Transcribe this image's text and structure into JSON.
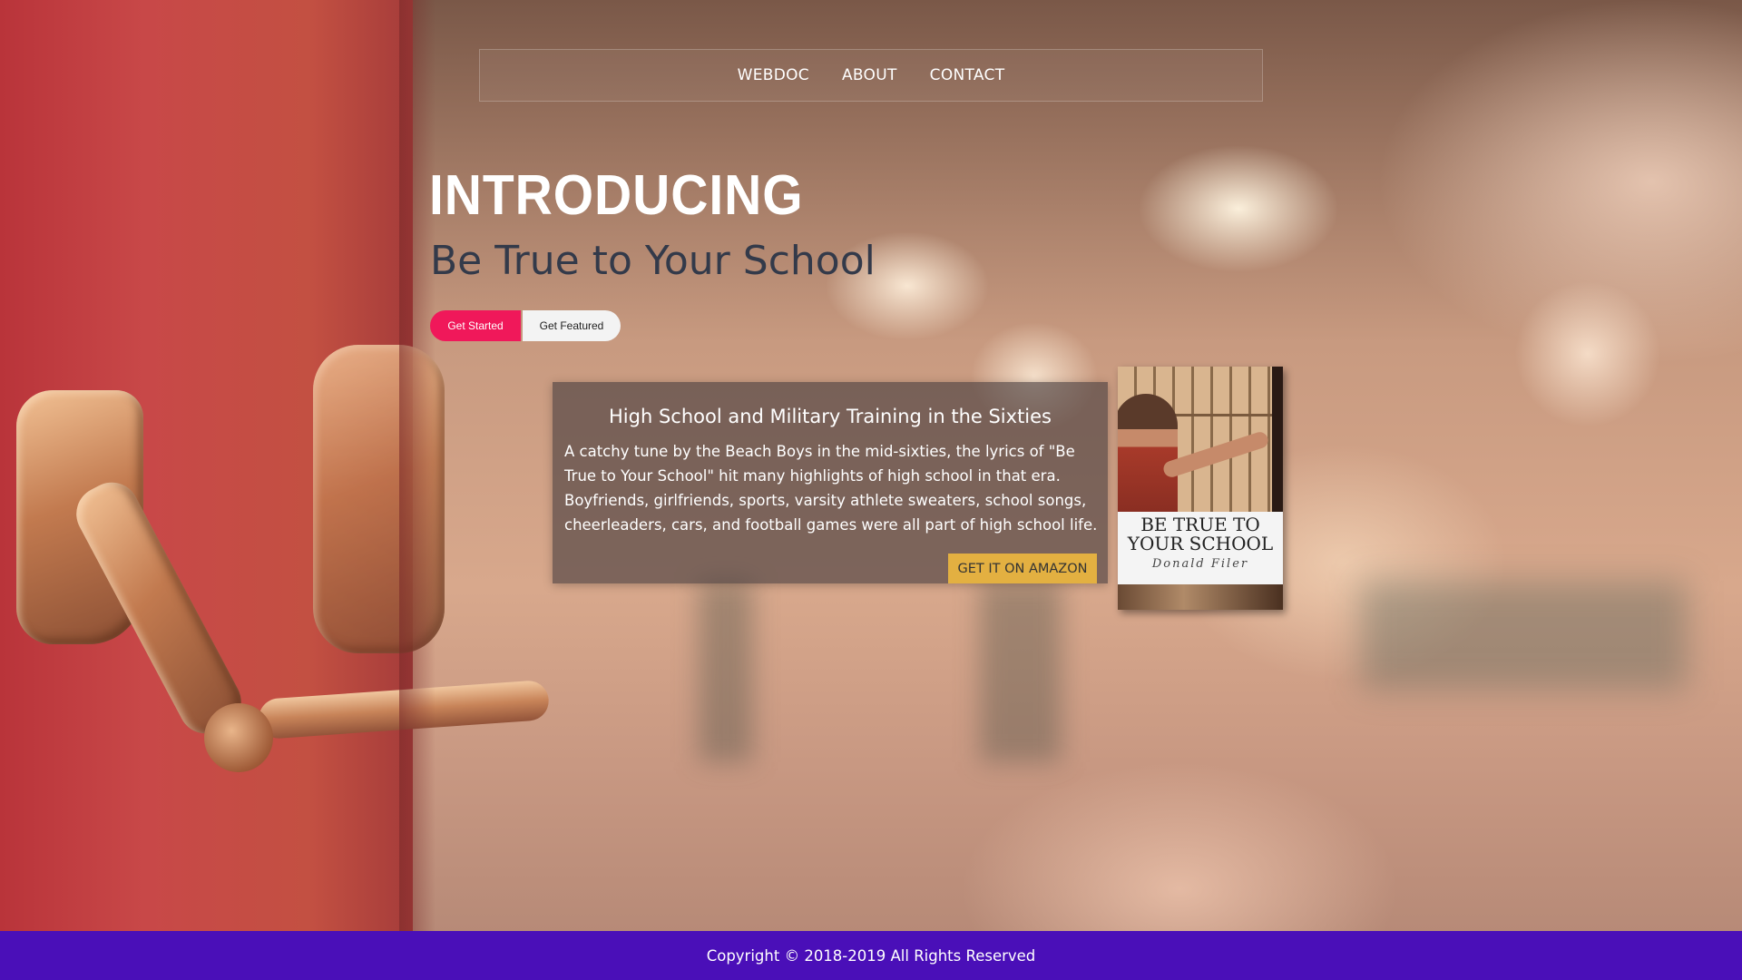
{
  "nav": {
    "items": [
      {
        "label": "WEBDOC"
      },
      {
        "label": "ABOUT"
      },
      {
        "label": "CONTACT"
      }
    ]
  },
  "hero": {
    "title": "INTRODUCING",
    "subtitle": "Be True to Your School",
    "primary_button": "Get Started",
    "secondary_button": "Get Featured"
  },
  "card": {
    "heading": "High School and Military Training in the Sixties",
    "body": "A catchy tune by the Beach Boys in the mid-sixties, the lyrics of \"Be True to Your School\" hit many highlights of high school in that era. Boyfriends, girlfriends, sports, varsity athlete sweaters, school songs, cheerleaders, cars, and football games were all part of high school life.",
    "button": "GET IT ON AMAZON"
  },
  "book": {
    "title_line1": "BE TRUE TO",
    "title_line2": "YOUR SCHOOL",
    "author": "Donald Filer"
  },
  "footer": {
    "copyright": "Copyright © 2018-2019 All Rights Reserved"
  },
  "colors": {
    "primary_button": "#f0185a",
    "amazon_button": "#e3b041",
    "footer": "#4a0fb8"
  },
  "icons": []
}
